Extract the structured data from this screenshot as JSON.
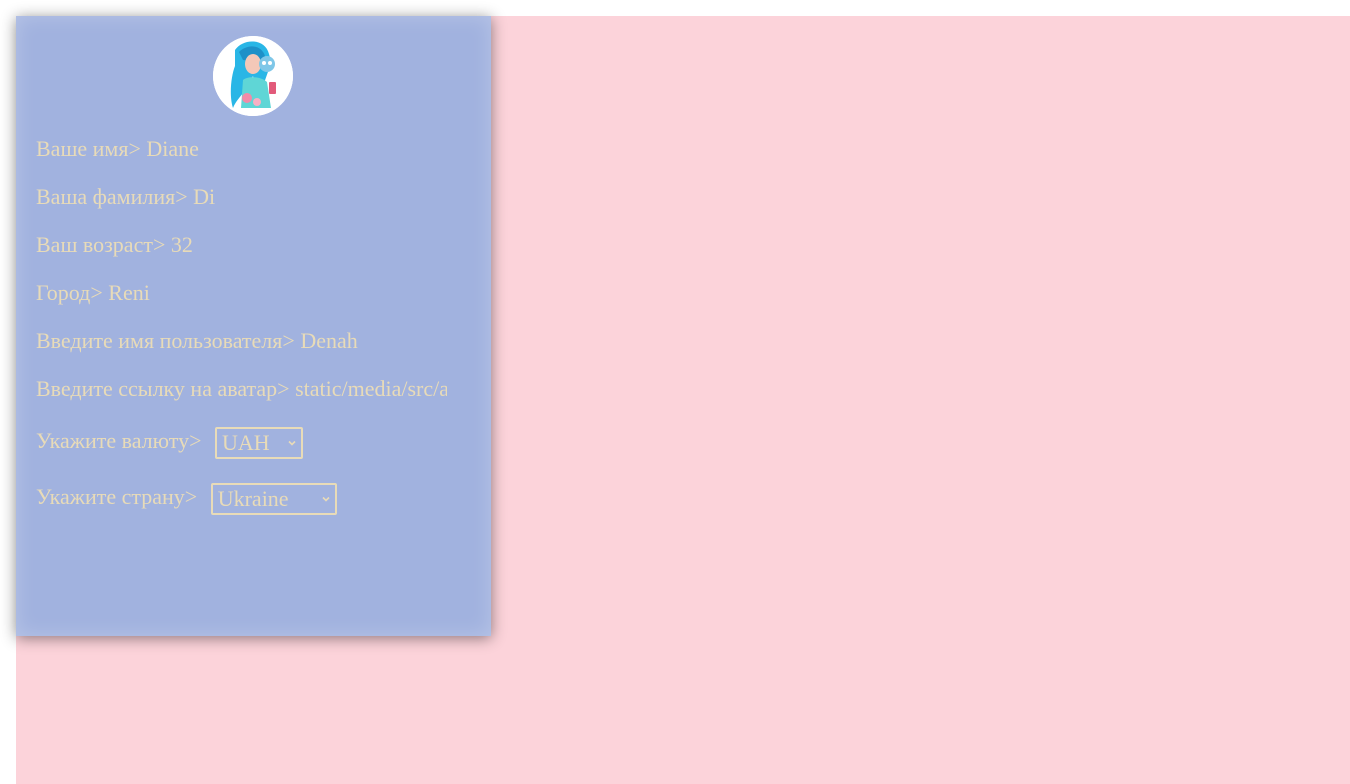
{
  "profile": {
    "avatar_alt": "avatar",
    "fields": [
      {
        "label": "Ваше имя>",
        "value": "Diane"
      },
      {
        "label": "Ваша фамилия>",
        "value": "Di"
      },
      {
        "label": "Ваш возраст>",
        "value": "32"
      },
      {
        "label": "Город>",
        "value": "Reni"
      },
      {
        "label": "Введите имя пользователя>",
        "value": "Denah"
      },
      {
        "label": "Введите ссылку на аватар>",
        "value": "static/media/src/avatar"
      }
    ],
    "currency": {
      "label": "Укажите валюту>",
      "selected": "UAH"
    },
    "country": {
      "label": "Укажите страну>",
      "selected": "Ukraine"
    }
  },
  "colors": {
    "page_background": "#fcd3da",
    "panel_background": "#a1b2df",
    "text": "#e8dbb8"
  }
}
